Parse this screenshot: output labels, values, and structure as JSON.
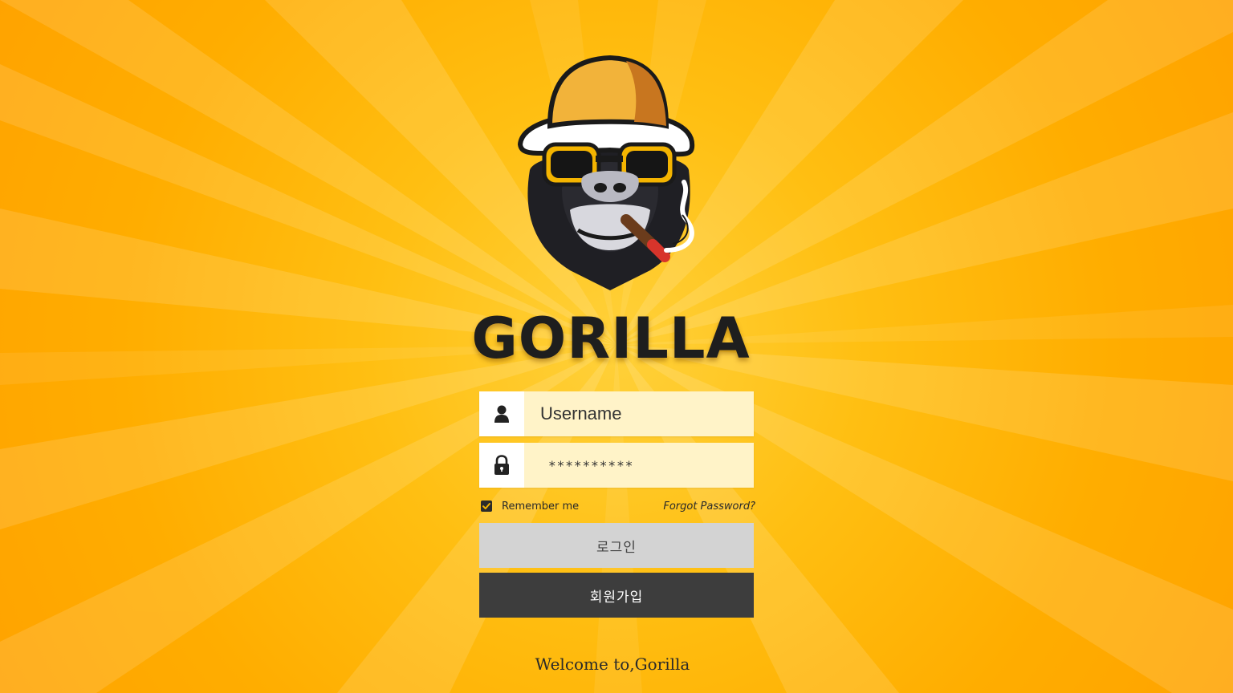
{
  "brand": {
    "name": "GORILLA",
    "logo_icon": "gorilla-mascot-icon"
  },
  "form": {
    "username": {
      "placeholder": "Username",
      "value": "",
      "icon": "user-icon"
    },
    "password": {
      "placeholder": "",
      "value": "**********",
      "icon": "lock-icon"
    },
    "remember_me": {
      "label": "Remember me",
      "checked": true
    },
    "forgot_password": "Forgot Password?",
    "login_label": "로그인",
    "signup_label": "회원가입"
  },
  "footer": {
    "welcome": "Welcome to,Gorilla"
  },
  "colors": {
    "background": "#ffb400",
    "input_bg": "#fff3c8",
    "login_bg": "#d3d3d3",
    "signup_bg": "#3d3d3d",
    "text_dark": "#1e1e1e"
  }
}
